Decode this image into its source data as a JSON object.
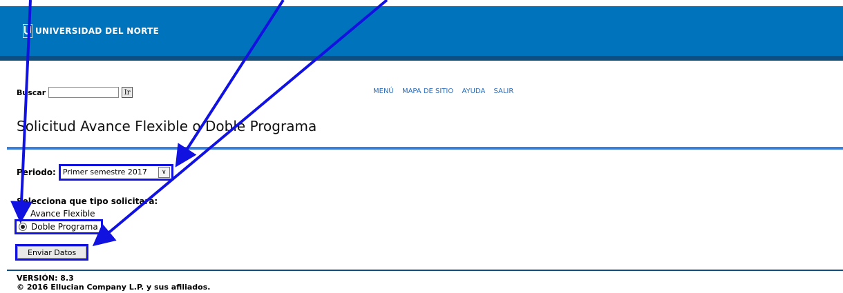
{
  "header": {
    "brand": "UNIVERSIDAD DEL NORTE",
    "colors": {
      "header_bg": "#0073bd",
      "header_bottom": "#0d4f80",
      "accent_rule": "#3a7fd5",
      "highlight": "#1212e0"
    }
  },
  "search": {
    "label": "Buscar",
    "value": "",
    "go_label": "Ir"
  },
  "topnav": {
    "items": [
      "MENÚ",
      "MAPA DE SITIO",
      "AYUDA",
      "SALIR"
    ]
  },
  "page": {
    "title": "Solicitud Avance Flexible o Doble Programa"
  },
  "form": {
    "periodo_label": "Periodo:",
    "periodo_value": "Primer semestre 2017",
    "tipo_heading": "Selecciona que tipo solicitará:",
    "options": [
      {
        "label": "Avance Flexible",
        "checked": false
      },
      {
        "label": "Doble Programa",
        "checked": true
      }
    ],
    "submit_label": "Enviar Datos"
  },
  "footer": {
    "version": "VERSIÓN: 8.3",
    "copyright": "© 2016 Ellucian Company L.P. y sus afiliados."
  }
}
